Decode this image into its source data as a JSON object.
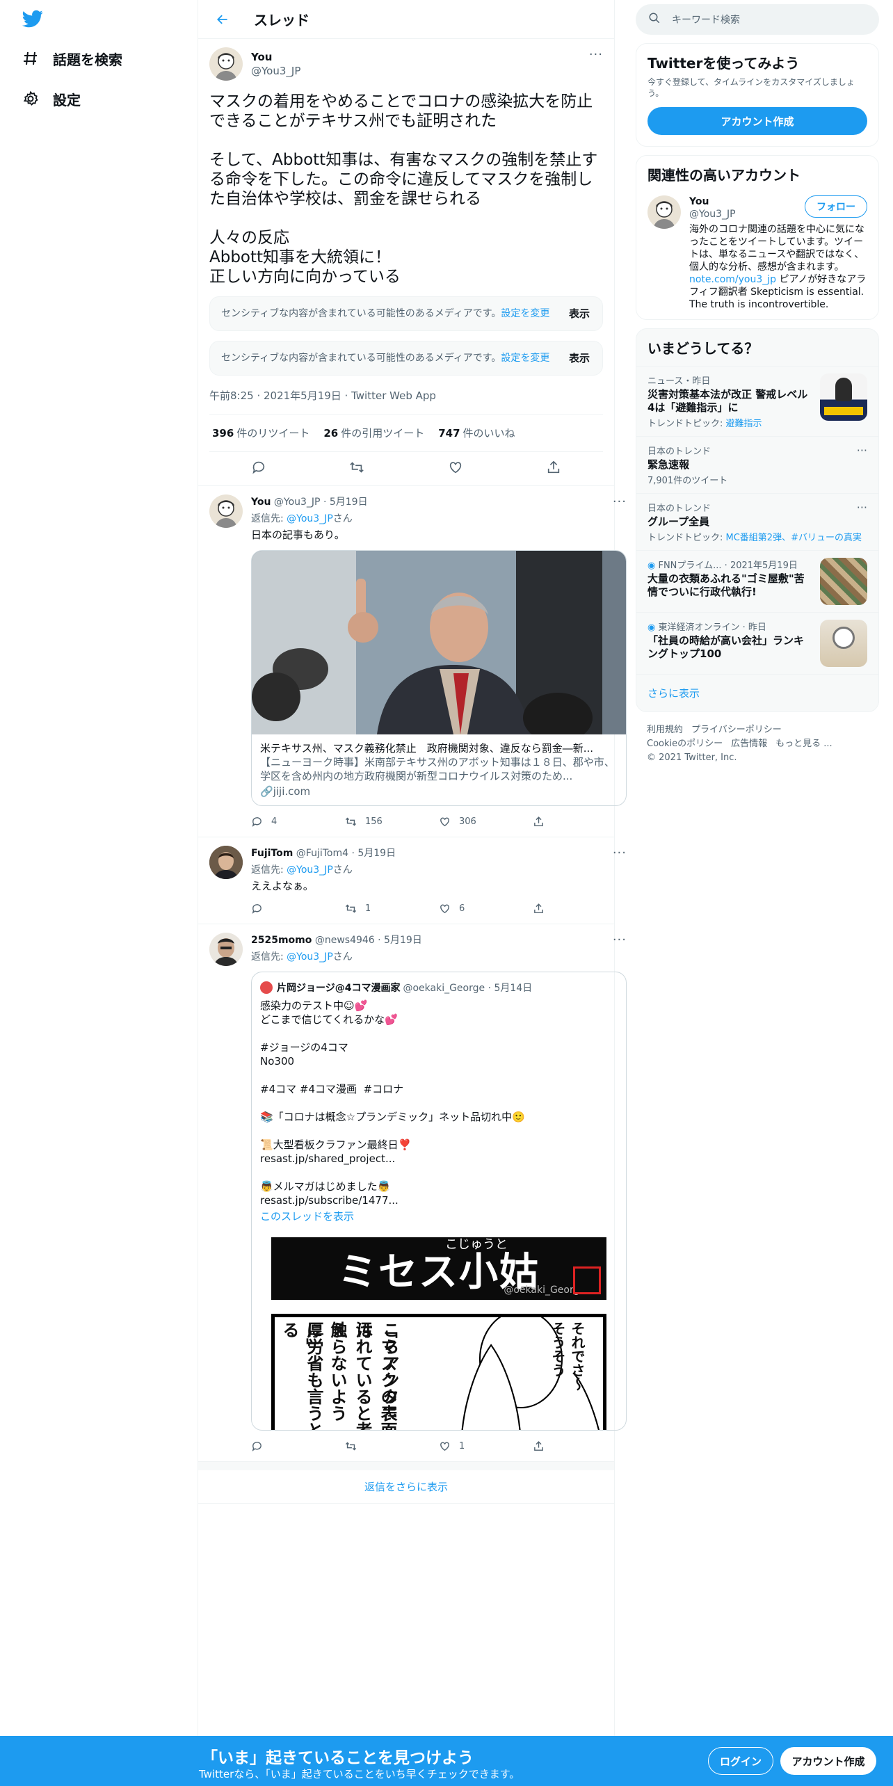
{
  "nav": {
    "explore_label": "話題を検索",
    "settings_label": "設定"
  },
  "header": {
    "title": "スレッド"
  },
  "focal": {
    "display_name": "You",
    "handle": "@You3_JP",
    "text": "マスクの着用をやめることでコロナの感染拡大を防止できることがテキサス州でも証明された\n\nそして、Abbott知事は、有害なマスクの強制を禁止する命令を下した。この命令に違反してマスクを強制した自治体や学校は、罰金を課せられる\n\n人々の反応\nAbbott知事を大統領に！\n正しい方向に向かっている",
    "sensitive_notice": "センシティブな内容が含まれている可能性のあるメディアです。",
    "sensitive_link": "設定を変更",
    "sensitive_show": "表示",
    "meta": "午前8:25 · 2021年5月19日 · Twitter Web App",
    "stats": [
      {
        "num": "396",
        "label": "件のリツイート"
      },
      {
        "num": "26",
        "label": "件の引用ツイート"
      },
      {
        "num": "747",
        "label": "件のいいね"
      }
    ]
  },
  "replies": [
    {
      "display_name": "You",
      "meta": "@You3_JP · 5月19日",
      "replyto_prefix": "返信先: ",
      "replyto_handle": "@You3_JP",
      "replyto_suffix": "さん",
      "text": "日本の記事もあり。",
      "card_title": "米テキサス州、マスク義務化禁止　政府機関対象、違反なら罰金―新...",
      "card_desc": "【ニューヨーク時事】米南部テキサス州のアボット知事は１８日、郡や市、学区を含め州内の地方政府機関が新型コロナウイルス対策のため...",
      "card_domain": "jiji.com",
      "reply_count": "4",
      "retweet_count": "156",
      "like_count": "306"
    },
    {
      "display_name": "FujiTom",
      "meta": "@FujiTom4 · 5月19日",
      "replyto_prefix": "返信先: ",
      "replyto_handle": "@You3_JP",
      "replyto_suffix": "さん",
      "text": "ええよなぁ。",
      "reply_count": "",
      "retweet_count": "1",
      "like_count": "6"
    },
    {
      "display_name": "2525momo",
      "meta": "@news4946 · 5月19日",
      "replyto_prefix": "返信先: ",
      "replyto_handle": "@You3_JP",
      "replyto_suffix": "さん",
      "reply_count": "",
      "retweet_count": "",
      "like_count": "1",
      "quote": {
        "display_name": "片岡ジョージ@4コマ漫画家",
        "meta": "@oekaki_George · 5月14日",
        "text": "感染力のテスト中☺💕\nどこまで信じてくれるかな💕\n\n#ジョージの4コマ\nNo300\n\n#4コマ #4コマ漫画  #コロナ\n\n📚「コロナは概念☆プランデミック」ネット品切れ中🙂\n\n📜大型看板クラファン最終日❣️\nresast.jp/shared_project...\n\n👼メルマガはじめました👼\nresast.jp/subscribe/1477...",
        "show_thread": "このスレッドを表示",
        "manga_title": "ミセス小姑",
        "manga_ruby": "こじゅうと",
        "manga_credit": "@oekaki_George",
        "manga_lines": [
          "そうそう",
          "それでさ〜",
          "こらアンタ!!",
          "「マスクの表面は",
          "汚れていると考え",
          "触らないように」",
          "厚労省も言うとる"
        ]
      }
    }
  ],
  "show_more_replies": "返信をさらに表示",
  "right": {
    "search_placeholder": "キーワード検索",
    "join": {
      "title": "Twitterを使ってみよう",
      "subtitle": "今すぐ登録して、タイムラインをカスタマイズしましょう。",
      "button": "アカウント作成"
    },
    "relevant": {
      "title": "関連性の高いアカウント",
      "display_name": "You",
      "handle": "@You3_JP",
      "follow": "フォロー",
      "bio_before": "海外のコロナ関連の話題を中心に気になったことをツイートしています。ツイートは、単なるニュースや翻訳ではなく、個人的な分析、感想が含まれます。",
      "bio_link": "note.com/you3_jp",
      "bio_after": " ピアノが好きなアラフィフ翻訳者 Skepticism is essential. The truth is incontrovertible."
    },
    "trends": {
      "title": "いまどうしてる？",
      "items": [
        {
          "context": "ニュース・昨日",
          "title": "災害対策基本法が改正 警戒レベル4は「避難指示」に",
          "topics_prefix": "トレンドトピック: ",
          "topics": "避難指示"
        },
        {
          "context": "日本のトレンド",
          "title": "緊急速報",
          "count": "7,901件のツイート"
        },
        {
          "context": "日本のトレンド",
          "title": "グループ全員",
          "topics_prefix": "トレンドトピック: ",
          "topics": "MC番組第2弾、#バリューの真実"
        },
        {
          "context": "FNNプライム... · 2021年5月19日",
          "title": "大量の衣類あふれる\"ゴミ屋敷\"苦情でついに行政代執行!"
        },
        {
          "context": "東洋経済オンライン · 昨日",
          "title": "「社員の時給が高い会社」ランキングトップ100"
        }
      ],
      "more": "さらに表示"
    },
    "footer": [
      "利用規約",
      "プライバシーポリシー",
      "Cookieのポリシー",
      "広告情報",
      "もっと見る ...",
      "© 2021 Twitter, Inc."
    ]
  },
  "bottom": {
    "title": "「いま」起きていることを見つけよう",
    "subtitle": "Twitterなら、「いま」起きていることをいち早くチェックできます。",
    "login": "ログイン",
    "signup": "アカウント作成"
  },
  "colors": {
    "accent": "#1d9bf0",
    "text": "#0f1419",
    "secondary": "#536471"
  }
}
